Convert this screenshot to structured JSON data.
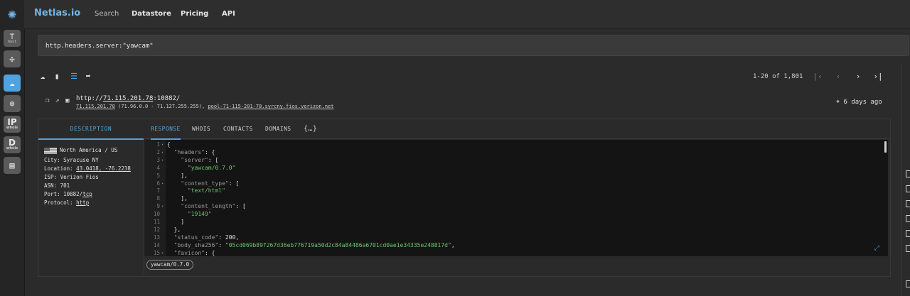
{
  "brand": "Netlas.io",
  "nav": {
    "search": "Search",
    "datastore": "Datastore",
    "pricing": "Pricing",
    "api": "API"
  },
  "rail": {
    "host_label": "host",
    "ip_label": "IP",
    "ip_sub": "whois",
    "d_label": "D",
    "d_sub": "whois"
  },
  "search": {
    "query": "http.headers.server:\"yawcam\""
  },
  "pager": {
    "range": "1-20 of 1,801"
  },
  "result": {
    "url_prefix": "http://",
    "ip": "71.115.201.78",
    "url_suffix": ":10882/",
    "range_text": " (71.96.0.0 - 71.127.255.255), ",
    "ptr": "pool-71-115-201-78.syrcny.fios.verizon.net",
    "ago": "6 days ago"
  },
  "tabs": {
    "description": "DESCRIPTION",
    "response": "RESPONSE",
    "whois": "WHOIS",
    "contacts": "CONTACTS",
    "domains": "DOMAINS",
    "raw": "{…}"
  },
  "description": {
    "region": "North America / US",
    "city": "City: Syracuse NY",
    "location_label": "Location: ",
    "location_value": "43.0418, -76.2238",
    "isp": "ISP: Verizon Fios",
    "asn": "ASN: 701",
    "port_label": "Port: 10882/",
    "port_proto": "tcp",
    "protocol_label": "Protocol: ",
    "protocol_value": "http"
  },
  "code_lines": [
    {
      "n": "1",
      "fold": true,
      "text": "{"
    },
    {
      "n": "2",
      "fold": true,
      "text": "  \"headers\": {"
    },
    {
      "n": "3",
      "fold": true,
      "text": "    \"server\": ["
    },
    {
      "n": "4",
      "fold": false,
      "text": "      \"yawcam/0.7.0\""
    },
    {
      "n": "5",
      "fold": false,
      "text": "    ],"
    },
    {
      "n": "6",
      "fold": true,
      "text": "    \"content_type\": ["
    },
    {
      "n": "7",
      "fold": false,
      "text": "      \"text/html\""
    },
    {
      "n": "8",
      "fold": false,
      "text": "    ],"
    },
    {
      "n": "9",
      "fold": true,
      "text": "    \"content_length\": ["
    },
    {
      "n": "10",
      "fold": false,
      "text": "      \"19149\""
    },
    {
      "n": "11",
      "fold": false,
      "text": "    ]"
    },
    {
      "n": "12",
      "fold": false,
      "text": "  },"
    },
    {
      "n": "13",
      "fold": false,
      "text": "  \"status_code\": 200,"
    },
    {
      "n": "14",
      "fold": false,
      "text": "  \"body_sha256\": \"05cd069b89f267d36eb776719a50d2c84a84486a6701cd0ae1e34335e248817d\","
    },
    {
      "n": "15",
      "fold": true,
      "text": "  \"favicon\": {"
    }
  ],
  "chip": "yawcam/0.7.0"
}
